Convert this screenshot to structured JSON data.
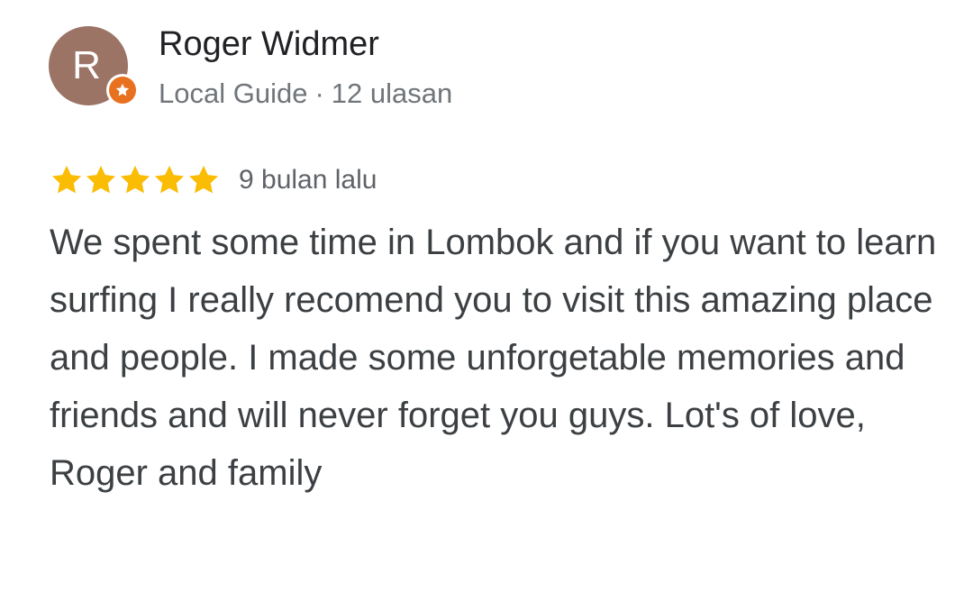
{
  "review": {
    "author": {
      "initial": "R",
      "name": "Roger Widmer",
      "badge": "Local Guide",
      "separator": "·",
      "review_count": "12 ulasan",
      "avatar_color": "#9b7466",
      "badge_color": "#e8711f",
      "badge_icon": "local-guide-star-icon"
    },
    "rating": {
      "stars": 5,
      "max": 5,
      "star_color": "#fbbc04",
      "time_ago": "9 bulan lalu"
    },
    "text": "We spent some time in Lombok and if you want to learn surfing I really recomend you to visit this amazing place and people. I made some unforgetable memories and friends and will never forget you guys. Lot's of love, Roger and family"
  }
}
